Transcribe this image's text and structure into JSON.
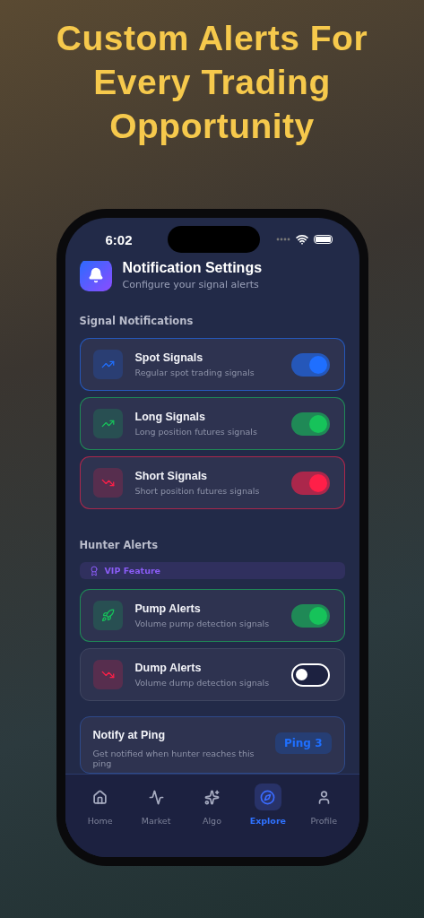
{
  "headline": "Custom Alerts For Every Trading Opportunity",
  "status_bar": {
    "time": "6:02"
  },
  "header": {
    "title": "Notification Settings",
    "subtitle": "Configure your signal alerts"
  },
  "sections": [
    {
      "title": "Signal Notifications",
      "items": [
        {
          "kind": "trend-up",
          "title": "Spot Signals",
          "subtitle": "Regular spot trading signals",
          "color": "#1f6fff",
          "on": true
        },
        {
          "kind": "trend-up",
          "title": "Long Signals",
          "subtitle": "Long position futures signals",
          "color": "#16c35a",
          "on": true
        },
        {
          "kind": "trend-down",
          "title": "Short Signals",
          "subtitle": "Short position futures signals",
          "color": "#ff1f48",
          "on": true
        }
      ]
    },
    {
      "title": "Hunter Alerts",
      "badge": "VIP Feature",
      "items": [
        {
          "kind": "rocket",
          "title": "Pump Alerts",
          "subtitle": "Volume pump detection signals",
          "color": "#16c35a",
          "on": true
        },
        {
          "kind": "trend-down",
          "title": "Dump Alerts",
          "subtitle": "Volume dump detection signals",
          "color": "#ff1f48",
          "on": false
        }
      ]
    }
  ],
  "ping": {
    "title": "Notify at Ping",
    "subtitle": "Get notified when hunter reaches this ping",
    "value": "Ping 3"
  },
  "nav": [
    {
      "kind": "home",
      "label": "Home",
      "selected": false
    },
    {
      "kind": "market",
      "label": "Market",
      "selected": false
    },
    {
      "kind": "algo",
      "label": "Algo",
      "selected": false
    },
    {
      "kind": "explore",
      "label": "Explore",
      "selected": true
    },
    {
      "kind": "profile",
      "label": "Profile",
      "selected": false
    }
  ]
}
